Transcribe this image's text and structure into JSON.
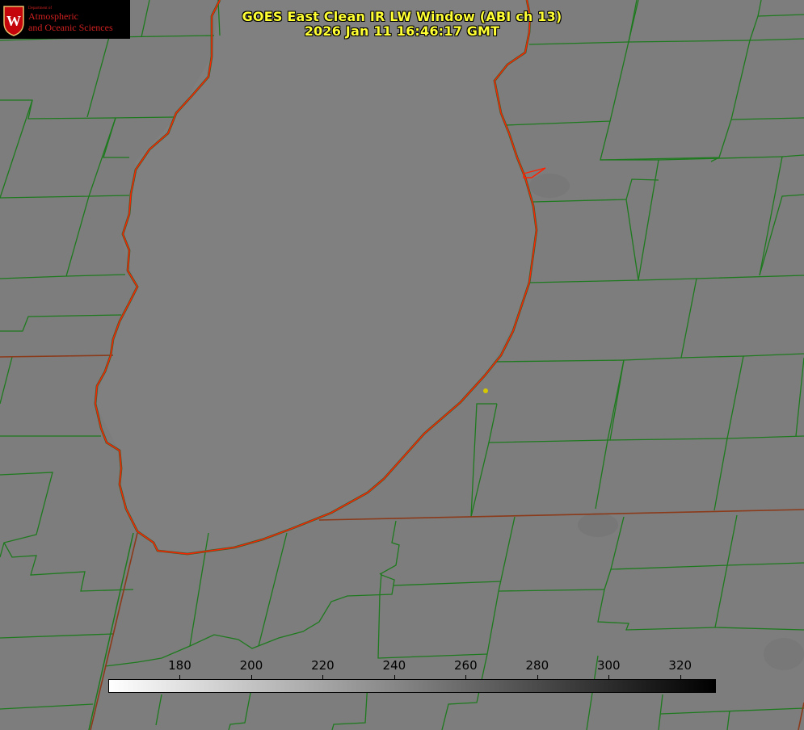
{
  "title": {
    "line1": "GOES East Clean IR LW Window (ABI ch 13)",
    "line2": "2026 Jan 11 16:46:17 GMT"
  },
  "logo": {
    "dept": "Department of",
    "line1": "Atmospheric",
    "line2": "and Oceanic Sciences",
    "crest_letter": "W"
  },
  "colorbar": {
    "min": 160,
    "max": 330,
    "ticks": [
      180,
      200,
      220,
      240,
      260,
      280,
      300,
      320
    ],
    "gradient_from": "#ffffff",
    "gradient_to": "#000000"
  },
  "colors": {
    "background": "#7d7d7d",
    "county_lines": "#1e7a1e",
    "coastline": "#ff2200",
    "title_text": "#ffff33",
    "marker": "#d4c800"
  }
}
